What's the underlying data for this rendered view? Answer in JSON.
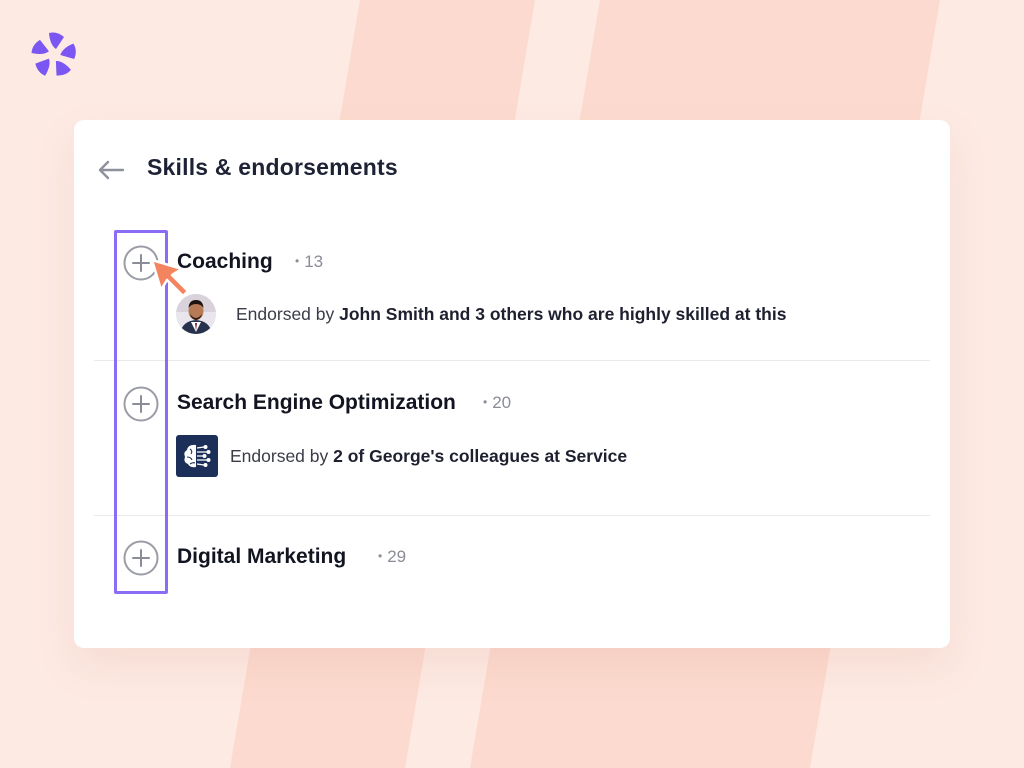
{
  "header": {
    "title": "Skills & endorsements"
  },
  "skills": [
    {
      "name": "Coaching",
      "count": "13",
      "endorse_prefix": "Endorsed by ",
      "endorse_bold": "John Smith and 3 others who are highly skilled at this",
      "badge": "avatar"
    },
    {
      "name": "Search Engine Optimization",
      "count": "20",
      "endorse_prefix": "Endorsed by ",
      "endorse_bold": "2 of George's colleagues at Service",
      "badge": "company-logo"
    },
    {
      "name": "Digital Marketing",
      "count": "29"
    }
  ],
  "colors": {
    "background": "#FDEAE3",
    "stripe": "#FCDACF",
    "card": "#FFFFFF",
    "brand": "#7B56F2",
    "highlight": "#8A6CF5",
    "cursor": "#F4845F",
    "company_logo_bg": "#1B2F58"
  },
  "icons": [
    "brand-logo-icon",
    "arrow-left-icon",
    "plus-circle-icon",
    "pointer-cursor-icon",
    "brain-circuit-icon"
  ]
}
